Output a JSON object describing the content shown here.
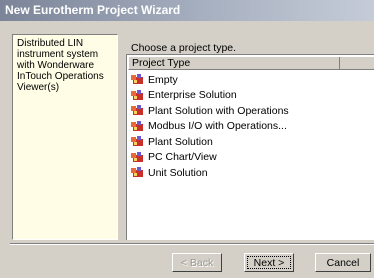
{
  "window": {
    "title": "New Eurotherm Project Wizard"
  },
  "description": {
    "text": "Distributed LIN instrument system with Wonderware InTouch Operations Viewer(s)"
  },
  "prompt": "Choose a project type.",
  "list": {
    "column_header": "Project Type",
    "items": [
      {
        "label": "Empty",
        "icon": "project-icon"
      },
      {
        "label": "Enterprise Solution",
        "icon": "project-icon"
      },
      {
        "label": "Plant Solution with Operations",
        "icon": "project-icon"
      },
      {
        "label": "Modbus I/O with Operations...",
        "icon": "project-icon"
      },
      {
        "label": "Plant Solution",
        "icon": "project-icon"
      },
      {
        "label": "PC Chart/View",
        "icon": "project-icon"
      },
      {
        "label": "Unit Solution",
        "icon": "project-icon"
      }
    ]
  },
  "buttons": {
    "back": "< Back",
    "next": "Next >",
    "cancel": "Cancel"
  }
}
